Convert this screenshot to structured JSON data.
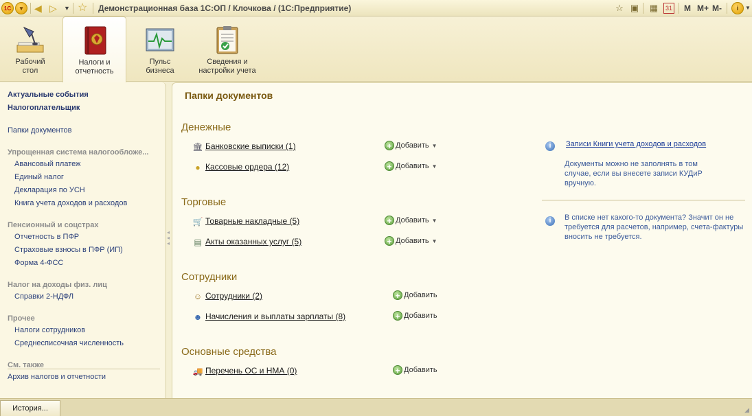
{
  "titlebar": {
    "logo_text": "1C",
    "title": "Демонстрационная база 1С:ОП / Клочкова / (1С:Предприятие)",
    "m_label": "M",
    "m_plus_label": "M+",
    "m_minus_label": "M-"
  },
  "sections": [
    {
      "label": "Рабочий\nстол",
      "icon": "desk-lamp-icon",
      "active": false
    },
    {
      "label": "Налоги и\nотчетность",
      "icon": "tax-book-icon",
      "active": true
    },
    {
      "label": "Пульс\nбизнеса",
      "icon": "pulse-monitor-icon",
      "active": false
    },
    {
      "label": "Сведения и\nнастройки учета",
      "icon": "clipboard-settings-icon",
      "active": false
    }
  ],
  "left_panel": {
    "top_links": [
      "Актуальные события",
      "Налогоплательщик"
    ],
    "folders_link": "Папки документов",
    "groups": [
      {
        "title": "Упрощенная система налогообложе...",
        "items": [
          "Авансовый платеж",
          "Единый налог",
          "Декларация по УСН",
          "Книга учета доходов и расходов"
        ]
      },
      {
        "title": "Пенсионный и соцстрах",
        "items": [
          "Отчетность в ПФР",
          "Страховые взносы в ПФР (ИП)",
          "Форма 4-ФСС"
        ]
      },
      {
        "title": "Налог на доходы физ. лиц",
        "items": [
          "Справки  2-НДФЛ"
        ]
      },
      {
        "title": "Прочее",
        "items": [
          "Налоги сотрудников",
          "Среднесписочная численность"
        ]
      }
    ],
    "see_also_title": "См. также",
    "see_also_items": [
      "Архив налогов и отчетности"
    ]
  },
  "main": {
    "title": "Папки документов",
    "add_label": "Добавить",
    "groups": [
      {
        "title": "Денежные",
        "rows": [
          {
            "label": "Банковские выписки (1)",
            "icon": "bank-icon",
            "has_dropdown": true
          },
          {
            "label": "Кассовые ордера (12)",
            "icon": "coins-icon",
            "has_dropdown": true
          }
        ]
      },
      {
        "title": "Торговые",
        "rows": [
          {
            "label": "Товарные накладные (5)",
            "icon": "cart-icon",
            "has_dropdown": true
          },
          {
            "label": "Акты оказанных услуг (5)",
            "icon": "document-icon",
            "has_dropdown": true
          }
        ]
      },
      {
        "title": "Сотрудники",
        "rows": [
          {
            "label": "Сотрудники (2)",
            "icon": "employee-icon",
            "has_dropdown": false
          },
          {
            "label": "Начисления и выплаты зарплаты (8)",
            "icon": "salary-icon",
            "has_dropdown": false
          }
        ]
      },
      {
        "title": "Основные средства",
        "rows": [
          {
            "label": "Перечень ОС и НМА (0)",
            "icon": "truck-icon",
            "has_dropdown": false
          }
        ]
      }
    ],
    "info": {
      "link": "Записи Книги учета доходов и расходов",
      "text1": "Документы можно не заполнять в том случае, если вы внесете записи КУДиР вручную.",
      "text2": "В списке нет какого-то документа? Значит он не требуется для расчетов, например, счета-фактуры вносить не требуется."
    }
  },
  "bottombar": {
    "history_label": "История..."
  }
}
